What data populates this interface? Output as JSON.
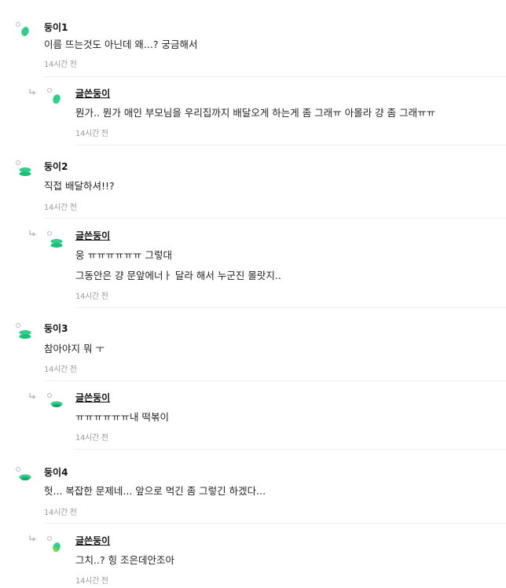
{
  "colors": {
    "accent": "#2ecf8a",
    "accent_dark": "#1aa86a"
  },
  "threads": [
    {
      "comment": {
        "author": "둥이1",
        "text": "이름 뜨는것도 아닌데 왜...? 궁금해서",
        "time": "14시간 전"
      },
      "reply": {
        "author": "글쓴둥이",
        "lines": [
          "뭔가.. 뭔가 애인 부모님을 우리집까지 배달오게 하는게 좀 그래ㅠ 아몰라 걍 좀 그래ㅠㅠ"
        ],
        "time": "14시간 전"
      }
    },
    {
      "comment": {
        "author": "둥이2",
        "text": "직접 배달하셔!!?",
        "time": "14시간 전"
      },
      "reply": {
        "author": "글쓴둥이",
        "lines": [
          "웅 ㅠㅠㅠㅠㅠㅠ 그렇대",
          "그동안은 걍 문앞에너ㅏ 달라 해서 누군진 몰랏지.."
        ],
        "time": "14시간 전"
      }
    },
    {
      "comment": {
        "author": "둥이3",
        "text": "참아야지 뭐 ㅜ",
        "time": "14시간 전"
      },
      "reply": {
        "author": "글쓴둥이",
        "lines": [
          "ㅠㅠㅠㅠㅠㅠ내 떡볶이"
        ],
        "time": "14시간 전"
      }
    },
    {
      "comment": {
        "author": "둥이4",
        "text": "헛... 복잡한 문제네... 앞으로 먹긴 좀 그렇긴 하겠다...",
        "time": "14시간 전"
      },
      "reply": {
        "author": "글쓴둥이",
        "lines": [
          "그치..? 힝 조은데안조아"
        ],
        "time": "14시간 전"
      }
    }
  ]
}
